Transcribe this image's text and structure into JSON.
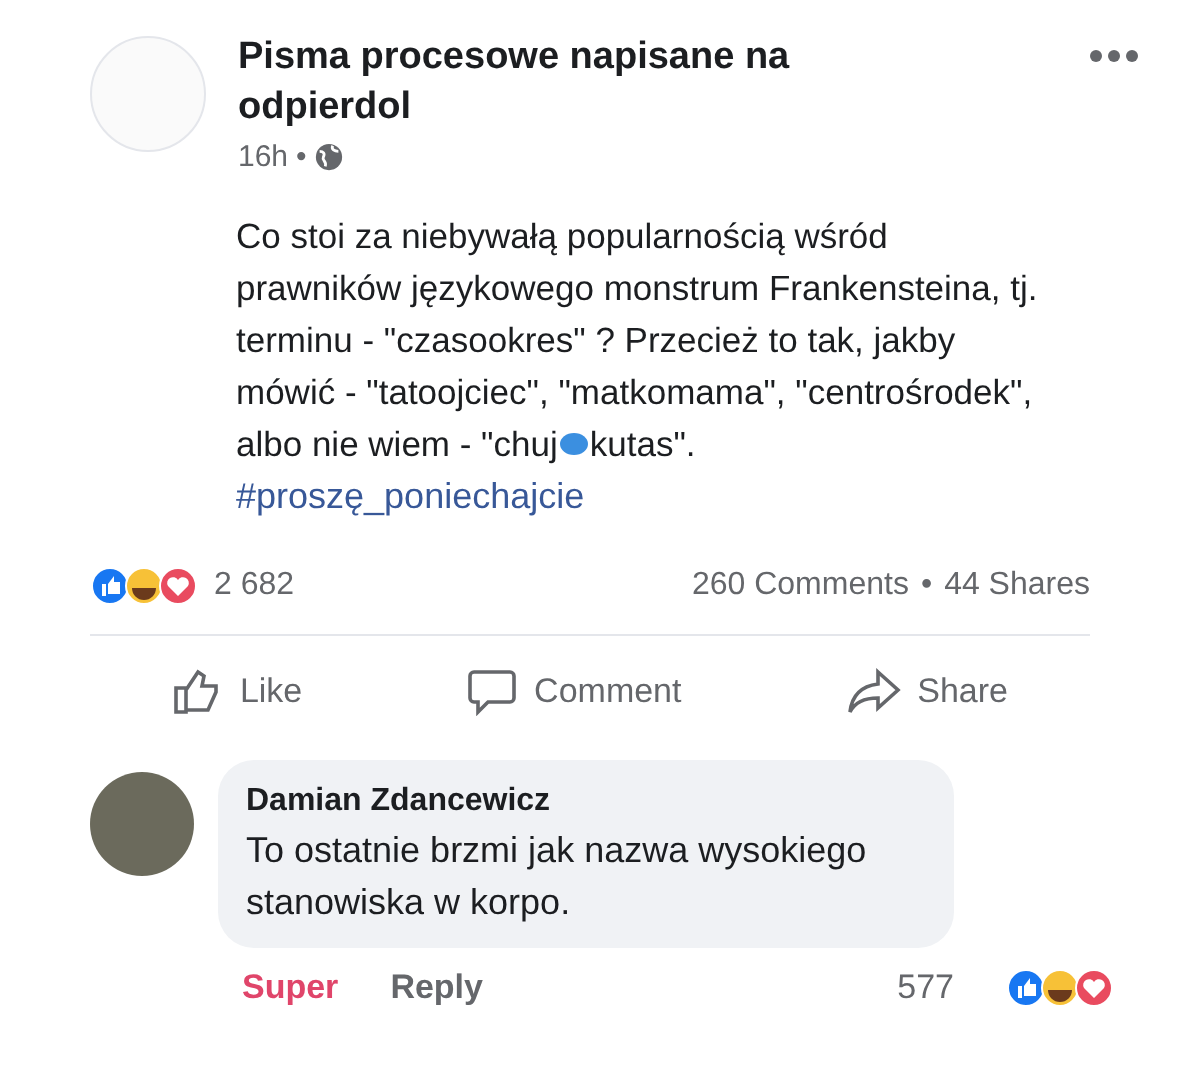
{
  "post": {
    "author": "Pisma procesowe napisane na odpierdol",
    "time": "16h",
    "separator": "•",
    "lines": [
      {
        "kind": "plain",
        "text": "Co stoi za niebywałą popularnością wśród"
      },
      {
        "kind": "plain",
        "text": "prawników językowego monstrum Frankensteina, tj."
      },
      {
        "kind": "plain",
        "text": "terminu - \"czasookres\" ? Przecież to tak, jakby"
      },
      {
        "kind": "plain",
        "text": "mówić - \"tatoojciec\", \"matkomama\", \"centrośrodek\","
      },
      {
        "kind": "censored",
        "before": "albo nie wiem - \"chuj",
        "after": "kutas\"."
      }
    ],
    "hashtag": "#proszę_poniechajcie"
  },
  "stats": {
    "reactions_count": "2 682",
    "comments": "260 Comments",
    "separator": "•",
    "shares": "44 Shares"
  },
  "actions": [
    {
      "kind": "like",
      "label": "Like"
    },
    {
      "kind": "comment",
      "label": "Comment"
    },
    {
      "kind": "share",
      "label": "Share"
    }
  ],
  "comment": {
    "author": "Damian Zdancewicz",
    "text": "To ostatnie brzmi jak nazwa wysokiego stanowiska w korpo.",
    "reaction_label": "Super",
    "reply_label": "Reply",
    "reactions_count": "577"
  }
}
